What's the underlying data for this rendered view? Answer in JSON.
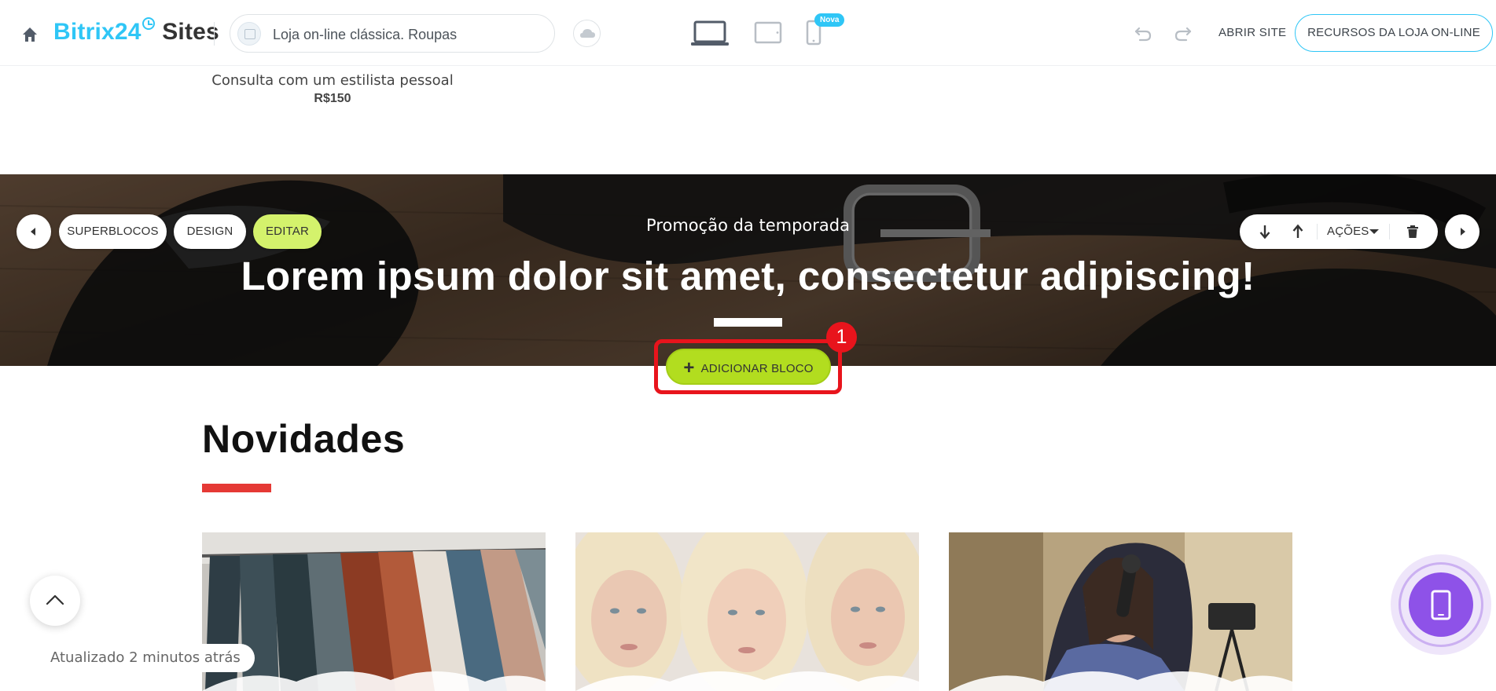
{
  "toolbar": {
    "logo_brand": "Bitrix24",
    "logo_product": "Sites",
    "site_name": "Loja on-line clássica. Roupas",
    "new_badge": "Nova",
    "open_site_label": "ABRIR SITE",
    "store_resources_label": "RECURSOS DA LOJA ON-LINE"
  },
  "product": {
    "name": "Consulta com um estilista pessoal",
    "price": "R$150"
  },
  "banner": {
    "subtitle": "Promoção da temporada",
    "title": "Lorem ipsum dolor sit amet, consectetur adipiscing!"
  },
  "block_controls": {
    "superblocks_label": "SUPERBLOCOS",
    "design_label": "DESIGN",
    "edit_label": "EDITAR",
    "actions_label": "AÇÕES"
  },
  "add_block": {
    "label": "ADICIONAR BLOCO",
    "step_number": "1"
  },
  "section": {
    "title": "Novidades"
  },
  "status": {
    "updated_text": "Atualizado 2 minutos atrás"
  },
  "colors": {
    "brand": "#2fc6f6",
    "edit_pill": "#d4f26c",
    "add_block": "#b2dd1f",
    "highlight": "#e8141c",
    "section_accent": "#e53935",
    "mobile_preview": "#8e52e8"
  },
  "icons": [
    "home-icon",
    "cloud-icon",
    "desktop-icon",
    "tablet-icon",
    "mobile-icon",
    "undo-icon",
    "redo-icon",
    "arrow-left-icon",
    "arrow-right-icon",
    "arrow-down-icon",
    "arrow-up-icon",
    "caret-down-icon",
    "trash-icon",
    "plus-icon",
    "chevron-up-icon",
    "phone-icon"
  ]
}
